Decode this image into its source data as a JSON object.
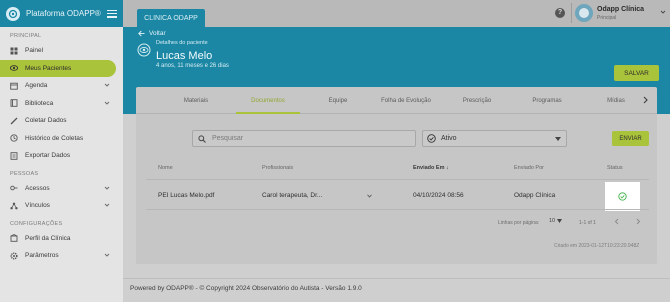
{
  "brand": {
    "title": "Plataforma ODAPP®"
  },
  "sidebar": {
    "sections": [
      {
        "title": "PRINCIPAL",
        "items": [
          {
            "label": "Painel",
            "icon": "grid-icon"
          },
          {
            "label": "Meus Pacientes",
            "icon": "eye-icon",
            "active": true
          },
          {
            "label": "Agenda",
            "icon": "calendar-icon",
            "expandable": true
          },
          {
            "label": "Biblioteca",
            "icon": "book-icon",
            "expandable": true
          },
          {
            "label": "Coletar Dados",
            "icon": "pencil-icon"
          },
          {
            "label": "Histórico de Coletas",
            "icon": "history-icon"
          },
          {
            "label": "Exportar Dados",
            "icon": "export-icon"
          }
        ]
      },
      {
        "title": "PESSOAS",
        "items": [
          {
            "label": "Acessos",
            "icon": "key-icon",
            "expandable": true
          },
          {
            "label": "Vínculos",
            "icon": "link-icon",
            "expandable": true
          }
        ]
      },
      {
        "title": "CONFIGURAÇÕES",
        "items": [
          {
            "label": "Perfil da Clínica",
            "icon": "clinic-icon"
          },
          {
            "label": "Parâmetros",
            "icon": "gear-icon",
            "expandable": true
          }
        ]
      }
    ]
  },
  "topbar": {
    "clinic_tab": "CLINICA ODAPP",
    "help_label": "?",
    "user_name": "Odapp Clínica",
    "user_role": "Principal"
  },
  "header": {
    "back_label": "Voltar",
    "breadcrumb": "Detalhes do paciente",
    "patient_name": "Lucas Melo",
    "patient_age": "4 anos, 11 meses e 26 dias",
    "save_label": "SALVAR"
  },
  "tabs": [
    {
      "label": "Materiais"
    },
    {
      "label": "Documentos",
      "active": true
    },
    {
      "label": "Equipe"
    },
    {
      "label": "Folha de Evolução"
    },
    {
      "label": "Prescrição"
    },
    {
      "label": "Programas"
    },
    {
      "label": "Mídias"
    }
  ],
  "filters": {
    "search_placeholder": "Pesquisar",
    "status_value": "Ativo",
    "send_label": "ENVIAR"
  },
  "table": {
    "columns": [
      "Nome",
      "Profissionais",
      "Enviado Em",
      "Enviado Por",
      "Status"
    ],
    "rows": [
      {
        "name": "PEI Lucas Melo.pdf",
        "professionals": "Carol terapeuta, Dr...",
        "sent_at": "04/10/2024 08:56",
        "sent_by": "Odapp Clínica",
        "status": "check-circle-icon"
      }
    ]
  },
  "pagination": {
    "rows_per_page_label": "Linhas por página:",
    "rows_per_page": "10",
    "range": "1-1 of 1"
  },
  "created_text": "Criado em 2023-01-12T10:23:20.948Z",
  "footer": {
    "text": "Powered by ODAPP® - © Copyright 2024 Observatório do Autista - Versão 1.9.0"
  },
  "colors": {
    "primary": "#1c87a5",
    "accent": "#a9c33a"
  }
}
